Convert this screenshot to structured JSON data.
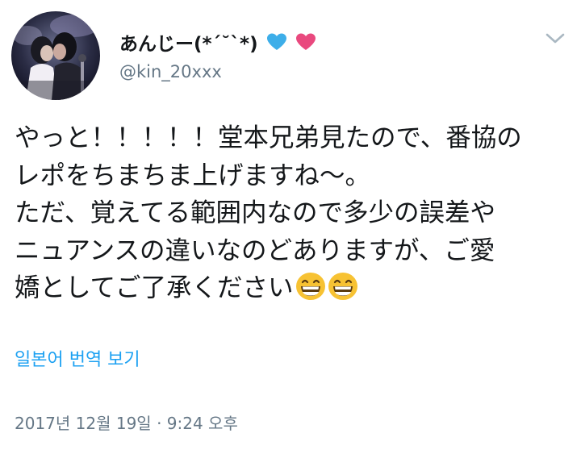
{
  "tweet": {
    "author": {
      "display_name": "あんじー(*´˘`*)",
      "handle": "@kin_20xxx",
      "avatar": "avatar-photo",
      "name_emojis": [
        {
          "icon": "blue-heart-icon",
          "color": "#3daee9"
        },
        {
          "icon": "pink-heart-icon",
          "color": "#e9497e"
        }
      ]
    },
    "menu_icon": "chevron-down-icon",
    "text": "やっと！！！！！堂本兄弟見たので、番協の\nレポをちまちま上げますね〜。\nただ、覚えてる範囲内なので多少の誤差や\nニュアンスの違いなのどありますが、ご愛\n嬌としてご了承ください",
    "text_emojis": [
      "grinning-face-icon",
      "grinning-face-icon"
    ],
    "translate_label": "일본어 번역 보기",
    "timestamp": "2017년 12월 19일 · 9:24 오후"
  },
  "colors": {
    "link": "#1da1f2",
    "secondary_text": "#657786",
    "primary_text": "#14171a"
  }
}
